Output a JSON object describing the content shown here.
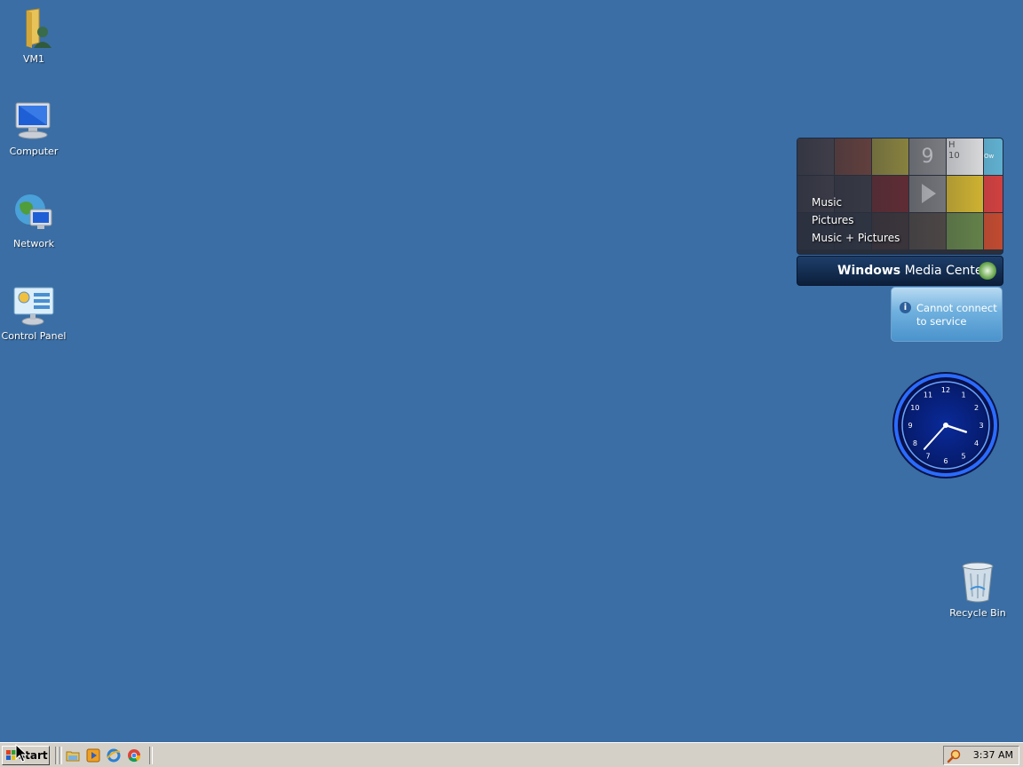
{
  "desktop": {
    "background_color": "#3a6ea5",
    "icons": [
      {
        "label": "VM1",
        "icon": "user-folder-icon"
      },
      {
        "label": "Computer",
        "icon": "computer-icon"
      },
      {
        "label": "Network",
        "icon": "network-icon"
      },
      {
        "label": "Control Panel",
        "icon": "control-panel-icon"
      },
      {
        "label": "Recycle Bin",
        "icon": "recycle-bin-icon"
      }
    ]
  },
  "gadgets": {
    "media_center": {
      "menu": [
        "Music",
        "Pictures",
        "Music + Pictures"
      ],
      "title_bold": "Windows",
      "title_rest": " Media Center",
      "tile_labels": [
        "9",
        "H",
        "10",
        "Ow"
      ]
    },
    "service": {
      "info_glyph": "i",
      "message": "Cannot connect to service"
    },
    "clock": {
      "numbers": [
        "12",
        "1",
        "2",
        "3",
        "4",
        "5",
        "6",
        "7",
        "8",
        "9",
        "10",
        "11"
      ],
      "time": "3:37"
    }
  },
  "taskbar": {
    "start_label": "start",
    "quick_launch": [
      "explorer-icon",
      "media-player-icon",
      "internet-explorer-icon",
      "chrome-icon"
    ],
    "clock": "3:37 AM"
  }
}
